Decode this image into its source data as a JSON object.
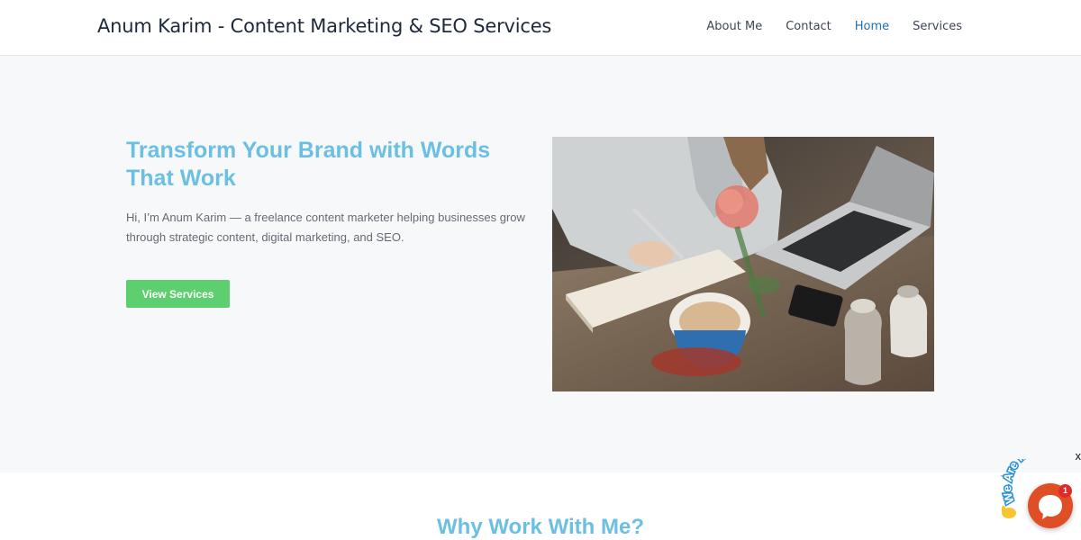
{
  "header": {
    "site_title": "Anum Karim - Content Marketing & SEO Services",
    "nav": [
      {
        "label": "About Me",
        "active": false
      },
      {
        "label": "Contact",
        "active": false
      },
      {
        "label": "Home",
        "active": true
      },
      {
        "label": "Services",
        "active": false
      }
    ]
  },
  "hero": {
    "title": "Transform Your Brand with Words That Work",
    "text": "Hi, I’m Anum Karim — a freelance content marketer helping businesses grow through strategic content, digital marketing, and SEO.",
    "button_label": "View Services",
    "image_icon": "writing-desk-photo"
  },
  "why_section": {
    "title": "Why Work With Me?"
  },
  "chat_widget": {
    "label": "We Are Here",
    "badge_count": "1",
    "close_glyph": "x",
    "wave_icon": "waving-hand-icon",
    "chat_icon": "chat-bubble-icon"
  },
  "colors": {
    "accent_blue": "#6bbfe3",
    "nav_active": "#1f6fba",
    "button_green": "#5dcf6f",
    "chat_orange": "#e04e26"
  }
}
